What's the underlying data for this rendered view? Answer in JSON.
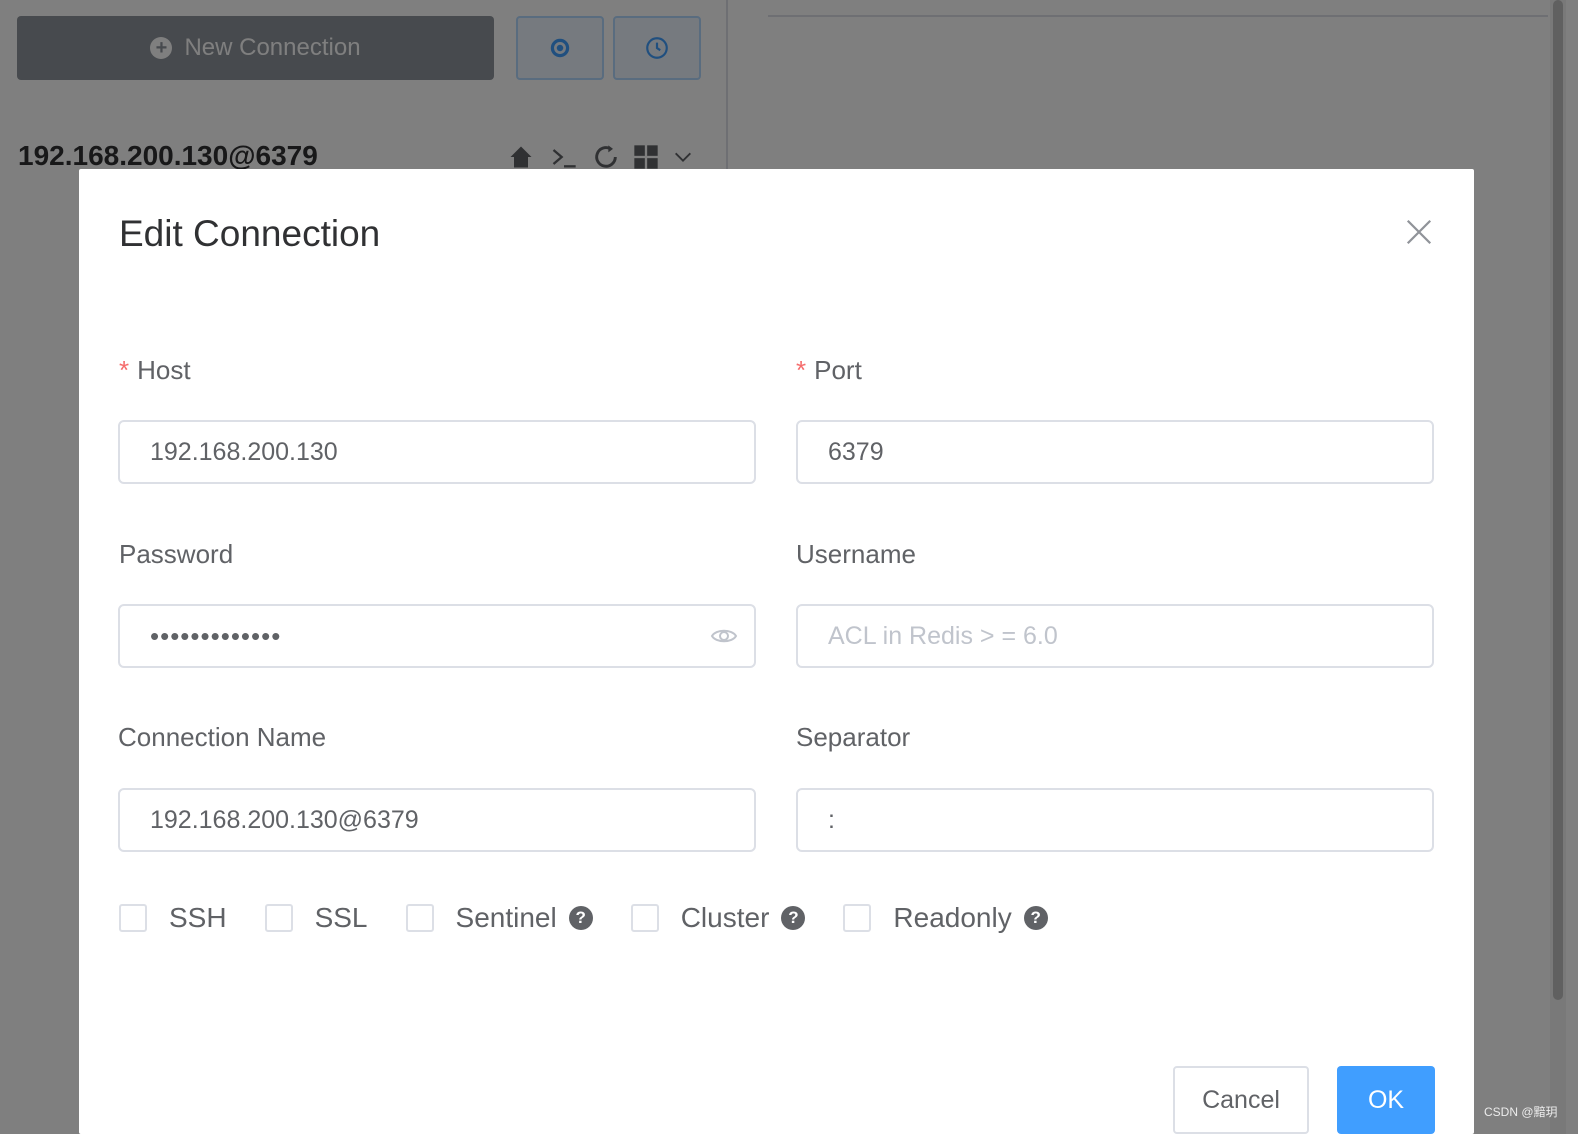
{
  "background": {
    "new_connection_label": "New Connection",
    "connection_title": "192.168.200.130@6379"
  },
  "dialog": {
    "title": "Edit Connection",
    "host": {
      "label": "Host",
      "value": "192.168.200.130"
    },
    "port": {
      "label": "Port",
      "value": "6379"
    },
    "password": {
      "label": "Password",
      "value": "•••••••••••••"
    },
    "username": {
      "label": "Username",
      "placeholder": "ACL in Redis > = 6.0"
    },
    "connection_name": {
      "label": "Connection Name",
      "value": "192.168.200.130@6379"
    },
    "separator": {
      "label": "Separator",
      "value": ":"
    },
    "checkboxes": [
      {
        "label": "SSH",
        "checked": false,
        "help": false
      },
      {
        "label": "SSL",
        "checked": false,
        "help": false
      },
      {
        "label": "Sentinel",
        "checked": false,
        "help": true
      },
      {
        "label": "Cluster",
        "checked": false,
        "help": true
      },
      {
        "label": "Readonly",
        "checked": false,
        "help": true
      }
    ],
    "help_glyph": "?",
    "cancel_label": "Cancel",
    "ok_label": "OK"
  },
  "watermark": "CSDN @黯玥",
  "colors": {
    "primary": "#409eff",
    "required": "#f56c6c",
    "overlay": "rgba(0,0,0,0.5)"
  }
}
